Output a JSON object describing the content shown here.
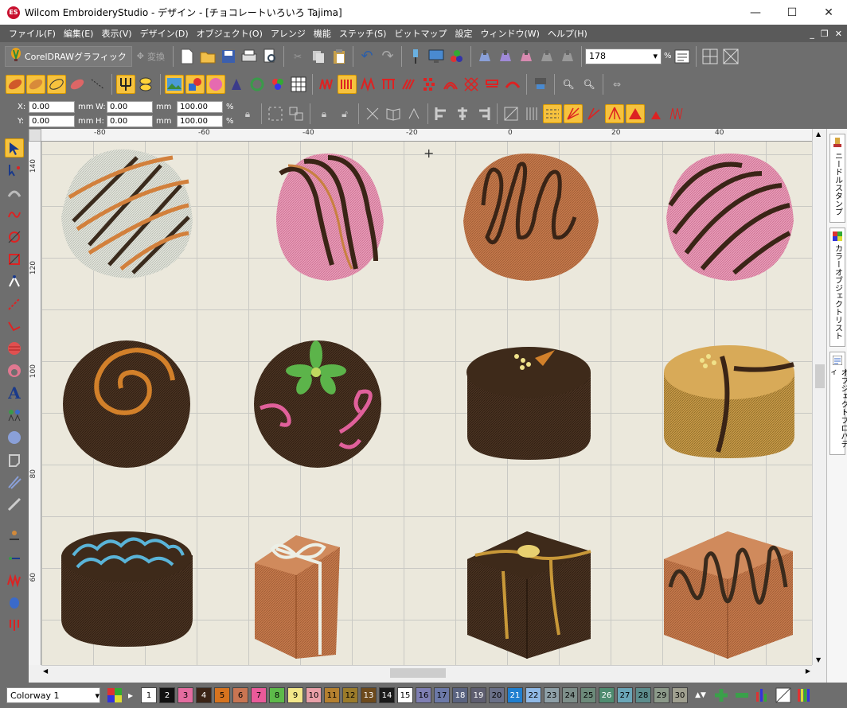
{
  "window": {
    "app_badge": "ES",
    "title": "Wilcom EmbroideryStudio - デザイン - [チョコレートいろいろ        Tajima]",
    "min_glyph": "—",
    "max_glyph": "☐",
    "close_glyph": "✕"
  },
  "menu": [
    "ファイル(F)",
    "編集(E)",
    "表示(V)",
    "デザイン(D)",
    "オブジェクト(O)",
    "アレンジ",
    "機能",
    "ステッチ(S)",
    "ビットマップ",
    "設定",
    "ウィンドウ(W)",
    "ヘルプ(H)"
  ],
  "toolbar": {
    "corel_label": "CorelDRAWグラフィック",
    "convert_label": "変換",
    "zoom_value": "178",
    "zoom_unit": "%"
  },
  "props": {
    "x_label": "X:",
    "x_value": "0.00",
    "x_unit": "mm",
    "y_label": "Y:",
    "y_value": "0.00",
    "y_unit": "mm",
    "w_label": "W:",
    "w_value": "0.00",
    "w_unit": "mm",
    "h_label": "H:",
    "h_value": "0.00",
    "h_unit": "mm",
    "sx_value": "100.00",
    "sy_value": "100.00",
    "pct": "%"
  },
  "ruler": {
    "h_ticks": [
      "-80",
      "-60",
      "-40",
      "-20",
      "0",
      "20",
      "40"
    ],
    "v_ticks": [
      "140",
      "120",
      "100",
      "80",
      "60"
    ]
  },
  "side_tabs": [
    "ニードルスタンプ",
    "カラーオブジェクトリスト",
    "オブジェクトプロパティ"
  ],
  "colorway": {
    "label": "Colorway 1"
  },
  "swatches": [
    {
      "n": "1",
      "c": "#ffffff"
    },
    {
      "n": "2",
      "c": "#111111"
    },
    {
      "n": "3",
      "c": "#e46ca0"
    },
    {
      "n": "4",
      "c": "#3b2416"
    },
    {
      "n": "5",
      "c": "#d6731e"
    },
    {
      "n": "6",
      "c": "#c97552"
    },
    {
      "n": "7",
      "c": "#ea5a9a"
    },
    {
      "n": "8",
      "c": "#5dba4a"
    },
    {
      "n": "9",
      "c": "#f4e88a"
    },
    {
      "n": "10",
      "c": "#e9a0a8"
    },
    {
      "n": "11",
      "c": "#b5802f"
    },
    {
      "n": "12",
      "c": "#9b7b2a"
    },
    {
      "n": "13",
      "c": "#6d4a1c"
    },
    {
      "n": "14",
      "c": "#1a1a1a"
    },
    {
      "n": "15",
      "c": "#ffffff"
    },
    {
      "n": "16",
      "c": "#7f7fb3"
    },
    {
      "n": "17",
      "c": "#6c79a8"
    },
    {
      "n": "18",
      "c": "#5a6380"
    },
    {
      "n": "19",
      "c": "#5e5e70"
    },
    {
      "n": "20",
      "c": "#6a7088"
    },
    {
      "n": "21",
      "c": "#1f7fd0"
    },
    {
      "n": "22",
      "c": "#8fb9e6"
    },
    {
      "n": "23",
      "c": "#8ea0a8"
    },
    {
      "n": "24",
      "c": "#7e8f8a"
    },
    {
      "n": "25",
      "c": "#6c8a7a"
    },
    {
      "n": "26",
      "c": "#4f8c70"
    },
    {
      "n": "27",
      "c": "#6aa6b8"
    },
    {
      "n": "28",
      "c": "#5c8c8c"
    },
    {
      "n": "29",
      "c": "#8c9a8a"
    },
    {
      "n": "30",
      "c": "#a0a090"
    }
  ]
}
